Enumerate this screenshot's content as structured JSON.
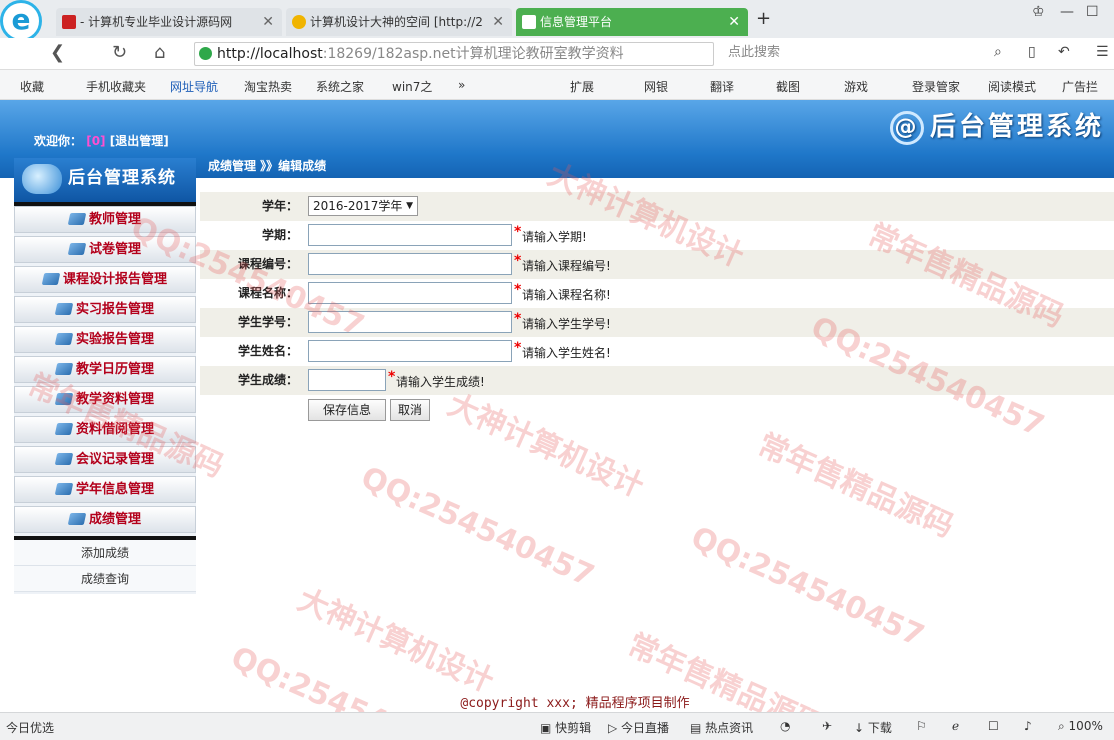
{
  "browser": {
    "tabs": [
      {
        "title": "- 计算机专业毕业设计源码网",
        "favicon_color": "#cc2222"
      },
      {
        "title": "计算机设计大神的空间 [http://2",
        "favicon_color": "#f0b400"
      },
      {
        "title": "信息管理平台",
        "favicon_color": "#ffffff"
      }
    ],
    "new_tab": "+",
    "url_host": "http://localhost",
    "url_rest": ":18269/182asp.net计算机理论教研室教学资料",
    "search_placeholder": "点此搜索",
    "bookmarks": [
      "收藏",
      "手机收藏夹",
      "网址导航",
      "淘宝热卖",
      "系统之家",
      "win7之",
      "»",
      "扩展",
      "网银",
      "翻译",
      "截图",
      "游戏",
      "登录管家",
      "阅读模式",
      "广告拦"
    ]
  },
  "header": {
    "welcome": "欢迎你：",
    "user": "[0]",
    "logout": "[退出管理]",
    "brand": "后台管理系统",
    "brand_icon": "@",
    "breadcrumb": "成绩管理 》》编辑成绩"
  },
  "sidebar": {
    "logo": "后台管理系统",
    "items": [
      "教师管理",
      "试卷管理",
      "课程设计报告管理",
      "实习报告管理",
      "实验报告管理",
      "教学日历管理",
      "教学资料管理",
      "资料借阅管理",
      "会议记录管理",
      "学年信息管理",
      "成绩管理"
    ],
    "sub_items": [
      "添加成绩",
      "成绩查询"
    ]
  },
  "form": {
    "year_label": "学年：",
    "year_value": "2016-2017学年",
    "fields": [
      {
        "label": "学期：",
        "hint": "请输入学期!",
        "value": ""
      },
      {
        "label": "课程编号：",
        "hint": "请输入课程编号!",
        "value": ""
      },
      {
        "label": "课程名称：",
        "hint": "请输入课程名称!",
        "value": ""
      },
      {
        "label": "学生学号：",
        "hint": "请输入学生学号!",
        "value": ""
      },
      {
        "label": "学生姓名：",
        "hint": "请输入学生姓名!",
        "value": ""
      }
    ],
    "score": {
      "label": "学生成绩：",
      "hint": "请输入学生成绩!",
      "value": ""
    },
    "required_mark": "*",
    "save_button": "保存信息",
    "cancel_button": "取消"
  },
  "footer": {
    "copyright": "@copyright xxx; 精品程序项目制作"
  },
  "statusbar": {
    "left": "今日优选",
    "items": [
      "快剪辑",
      "今日直播",
      "热点资讯",
      "下载"
    ],
    "zoom": "100%"
  },
  "watermarks": [
    "QQ:254540457",
    "大神计算机设计",
    "常年售精品源码"
  ],
  "colors": {
    "header_blue": "#1f77c9",
    "menu_text": "#b3001b",
    "active_tab": "#4caf50",
    "required": "#ee0000",
    "watermark": "#e65a5a"
  }
}
